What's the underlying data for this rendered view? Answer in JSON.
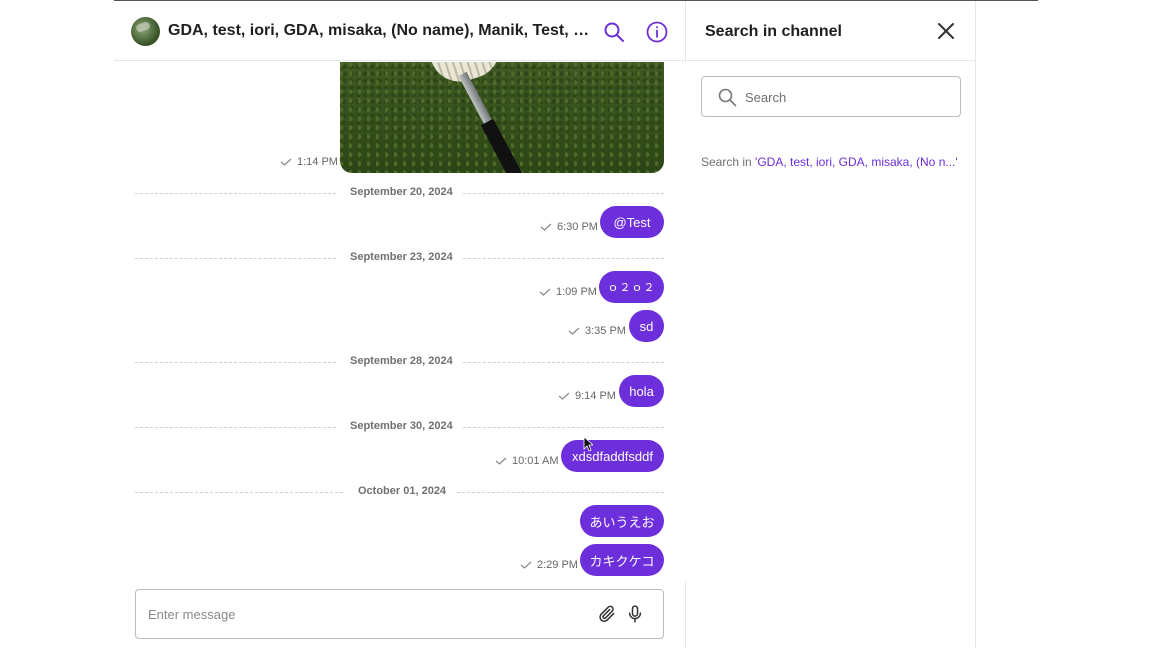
{
  "chat": {
    "title": "GDA, test, iori, GDA, misaka, (No name), Manik, Test, berk...",
    "image_time": "1:14 PM",
    "groups": [
      {
        "date": "September 20, 2024",
        "messages": [
          {
            "text": "@Test",
            "time": "6:30 PM"
          }
        ]
      },
      {
        "date": "September 23, 2024",
        "messages": [
          {
            "text": "ｏ２ｏ２",
            "time": "1:09 PM"
          },
          {
            "text": "sd",
            "time": "3:35 PM"
          }
        ]
      },
      {
        "date": "September 28, 2024",
        "messages": [
          {
            "text": "hola",
            "time": "9:14 PM"
          }
        ]
      },
      {
        "date": "September 30, 2024",
        "messages": [
          {
            "text": "xdsdfaddfsddf",
            "time": "10:01 AM"
          }
        ]
      },
      {
        "date": "October 01, 2024",
        "messages": [
          {
            "text": "あいうえお",
            "time": ""
          },
          {
            "text": "カキクケコ",
            "time": "2:29 PM"
          }
        ]
      }
    ],
    "composer_placeholder": "Enter message"
  },
  "panel": {
    "title": "Search in channel",
    "search_placeholder": "Search",
    "scope_prefix": "Search in ",
    "scope_channel": "'GDA, test, iori, GDA, misaka, (No n...'"
  },
  "icons": {
    "header": [
      "search-icon",
      "info-icon"
    ],
    "composer": [
      "paperclip-icon",
      "microphone-icon"
    ],
    "panel": [
      "close-icon",
      "search-icon"
    ],
    "message_status": "check-icon"
  },
  "colors": {
    "accent": "#6d2edb",
    "bubble_text": "#ffffff",
    "muted_text": "#6f6f6f"
  }
}
